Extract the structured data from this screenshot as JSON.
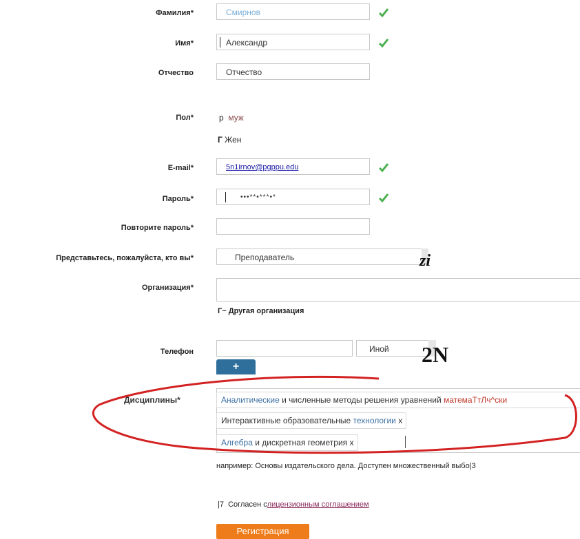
{
  "form": {
    "last_name": {
      "label": "Фамилия*",
      "value": "Смирнов"
    },
    "first_name": {
      "label": "Имя*",
      "value": "Александр"
    },
    "middle_name": {
      "label": "Отчество",
      "placeholder": "Отчество"
    },
    "gender": {
      "label": "Пол*",
      "male_marker": "р",
      "male": "муж",
      "female_marker": "Г",
      "female": "Жен"
    },
    "email": {
      "label": "E-mail*",
      "value": "5n1irnov@pgppu.edu"
    },
    "password": {
      "label": "Пароль*",
      "value": "•••**•***•*"
    },
    "password_repeat": {
      "label": "Повторите пароль*",
      "value": ""
    },
    "role": {
      "label": "Представьтесь, пожалуйста, кто вы*",
      "value": "Преподаватель",
      "scan_mark": "zi"
    },
    "organization": {
      "label": "Организация*",
      "value": "",
      "other_marker": "Г~",
      "other_label": "Другая организация"
    },
    "phone": {
      "label": "Телефон",
      "value": "",
      "type_value": "Иной",
      "scan_mark": "2N",
      "add_label": "+"
    },
    "disciplines": {
      "label": "Дисциплины*",
      "tags": [
        {
          "parts": [
            "Аналитические",
            " и численные методы решения уравнений ",
            "матемаТтЛч^ски"
          ]
        },
        {
          "parts": [
            "Интерактивные образовательные ",
            "технологии",
            " x"
          ]
        },
        {
          "parts": [
            "Алгебра",
            " и ",
            "дискретная геометрия x"
          ]
        }
      ],
      "hint": "например: Основы издательского дела. Доступен множественный выбо|3"
    },
    "agreement": {
      "marker": "|7",
      "text": "Согласен с",
      "link": "лицензионным соглашением"
    },
    "submit_label": "Регистрация"
  },
  "colors": {
    "check": "#4caf50",
    "annotation": "#d32222",
    "submit": "#ef7c1a",
    "add": "#2f6f9b"
  }
}
